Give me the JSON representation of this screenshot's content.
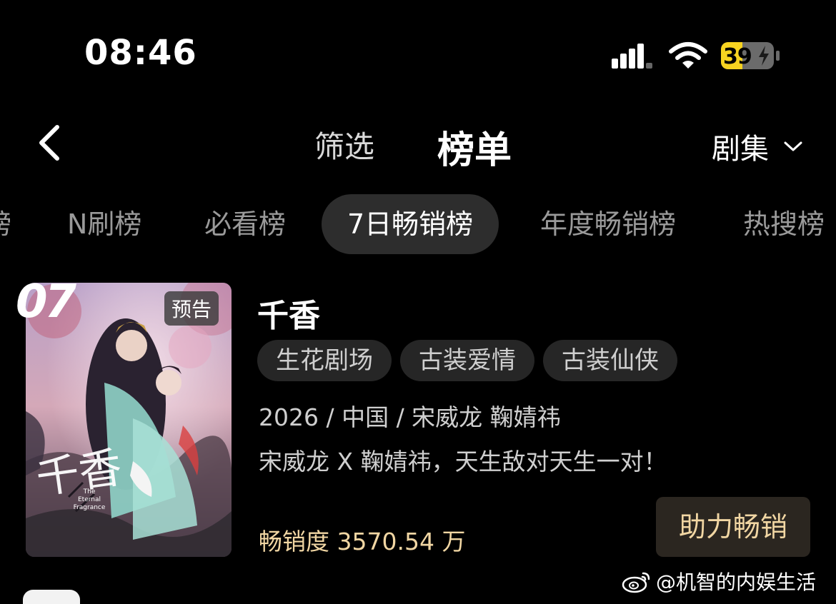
{
  "status": {
    "time": "08:46",
    "battery": "39"
  },
  "nav": {
    "filter_label": "筛选",
    "rank_label": "榜单",
    "category_label": "剧集"
  },
  "tabs": [
    {
      "label": "榜"
    },
    {
      "label": "N刷榜"
    },
    {
      "label": "必看榜"
    },
    {
      "label": "7日畅销榜"
    },
    {
      "label": "年度畅销榜"
    },
    {
      "label": "热搜榜"
    }
  ],
  "item": {
    "rank": "07",
    "badge": "预告",
    "poster_title": "千香",
    "poster_subtitle": "The Eternal Fragrance",
    "title": "千香",
    "tags": [
      "生花剧场",
      "古装爱情",
      "古装仙侠"
    ],
    "meta": "2026 / 中国 / 宋威龙 鞠婧祎",
    "desc": "宋威龙 X 鞠婧祎，天生敌对天生一对！",
    "sales": "畅销度 3570.54 万",
    "action_label": "助力畅销"
  },
  "watermark": {
    "text": "@机智的内娱生活"
  },
  "colors": {
    "accent_gold": "#f1d6a3",
    "battery_yellow": "#f7d320",
    "tab_active_bg": "#2d2d2d"
  }
}
